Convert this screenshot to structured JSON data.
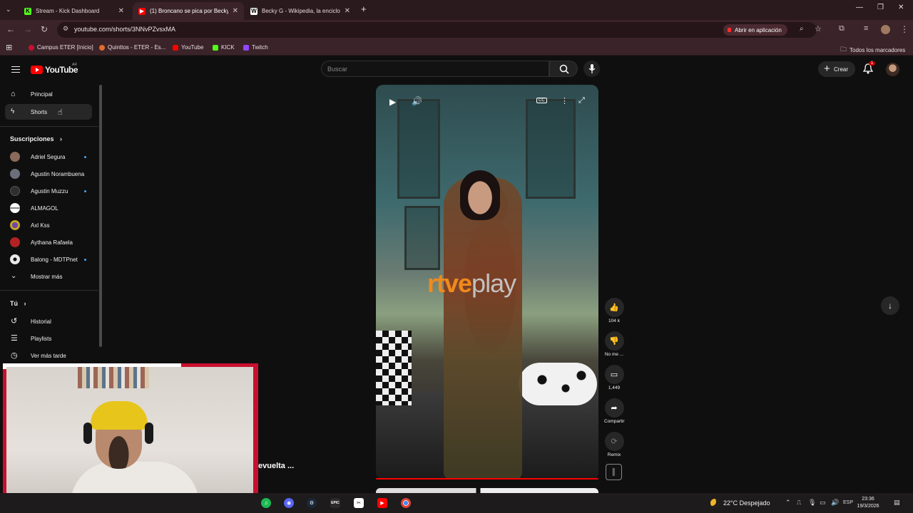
{
  "browser": {
    "tabs": [
      {
        "title": "Stream - Kick Dashboard",
        "favicon": "kick-icon",
        "favicon_color": "#53fc18",
        "active": false
      },
      {
        "title": "(1) Broncano se pica por Becky",
        "favicon": "youtube-icon",
        "favicon_color": "#ff0000",
        "active": true
      },
      {
        "title": "Becky G - Wikipedia, la enciclop",
        "favicon": "wikipedia-icon",
        "favicon_color": "#ffffff",
        "active": false
      }
    ],
    "url": "youtube.com/shorts/3NNvPZvsxMA",
    "open_in_app_label": "Abrir en aplicación",
    "bookmarks": [
      {
        "label": "Campus ETER [Inicio]",
        "color": "#c8102e"
      },
      {
        "label": "Quinttos - ETER - Es...",
        "color": "#e06b2c"
      },
      {
        "label": "YouTube",
        "color": "#ff0000"
      },
      {
        "label": "KICK",
        "color": "#53fc18"
      },
      {
        "label": "Twitch",
        "color": "#9146ff"
      }
    ],
    "all_bookmarks_label": "Todos los marcadores"
  },
  "youtube": {
    "logo_text": "YouTube",
    "country_code": "AR",
    "search_placeholder": "Buscar",
    "create_label": "Crear",
    "notification_count": "1",
    "sidebar": {
      "main": [
        {
          "label": "Principal",
          "icon": "home-icon",
          "selected": false
        },
        {
          "label": "Shorts",
          "icon": "shorts-icon",
          "selected": true
        }
      ],
      "subscriptions_header": "Suscripciones",
      "subscriptions": [
        {
          "label": "Adriel Segura",
          "new": true,
          "color": "#8a6a5a"
        },
        {
          "label": "Agustin Norambuena",
          "new": false,
          "color": "#6a6f7a"
        },
        {
          "label": "Agustin Muzzu",
          "new": true,
          "color": "#2f2f2f"
        },
        {
          "label": "ALMAGOL",
          "new": false,
          "color": "#ffffff"
        },
        {
          "label": "Axl Kss",
          "new": false,
          "color": "#c9a227"
        },
        {
          "label": "Aythana Rafaela",
          "new": false,
          "color": "#b22222"
        },
        {
          "label": "Balong - MDTPnet",
          "new": true,
          "color": "#e8e8e8"
        }
      ],
      "show_more_label": "Mostrar más",
      "you_header": "Tú",
      "you_items": [
        {
          "label": "Historial",
          "icon": "history-icon"
        },
        {
          "label": "Playlists",
          "icon": "playlists-icon"
        },
        {
          "label": "Ver más tarde",
          "icon": "clock-icon"
        }
      ]
    },
    "short": {
      "watermark_part1": "rtve",
      "watermark_part2": "play",
      "actions": [
        {
          "label": "104 k",
          "icon": "like-icon"
        },
        {
          "label": "No me ...",
          "icon": "dislike-icon"
        },
        {
          "label": "1,449",
          "icon": "comment-icon"
        },
        {
          "label": "Compartir",
          "icon": "share-icon"
        },
        {
          "label": "Remix",
          "icon": "remix-icon"
        }
      ],
      "caption_fragment": "evuelta ..."
    }
  },
  "taskbar": {
    "weather": "22°C  Despejado",
    "language": "ESP",
    "time": "23:36",
    "date": "19/3/2026"
  }
}
